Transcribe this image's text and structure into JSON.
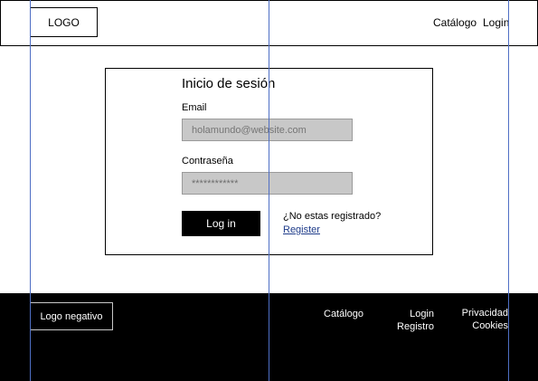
{
  "header": {
    "logo": "LOGO",
    "nav": {
      "catalog": "Catálogo",
      "login": "Login"
    }
  },
  "login_form": {
    "title": "Inicio de sesión",
    "email_label": "Email",
    "email_placeholder": "holamundo@website.com",
    "password_label": "Contraseña",
    "password_value": "************",
    "submit_label": "Log in",
    "register_prompt": "¿No estas registrado?",
    "register_link": "Register"
  },
  "footer": {
    "logo": "Logo negativo",
    "catalog": "Catálogo",
    "login": "Login",
    "register": "Registro",
    "privacy": "Privacidad",
    "cookies": "Cookies"
  },
  "colors": {
    "guide_lines": "#4f6fc4",
    "input_fill": "#c8c8c8",
    "footer_bg": "#000000",
    "link": "#1f3c8a"
  }
}
